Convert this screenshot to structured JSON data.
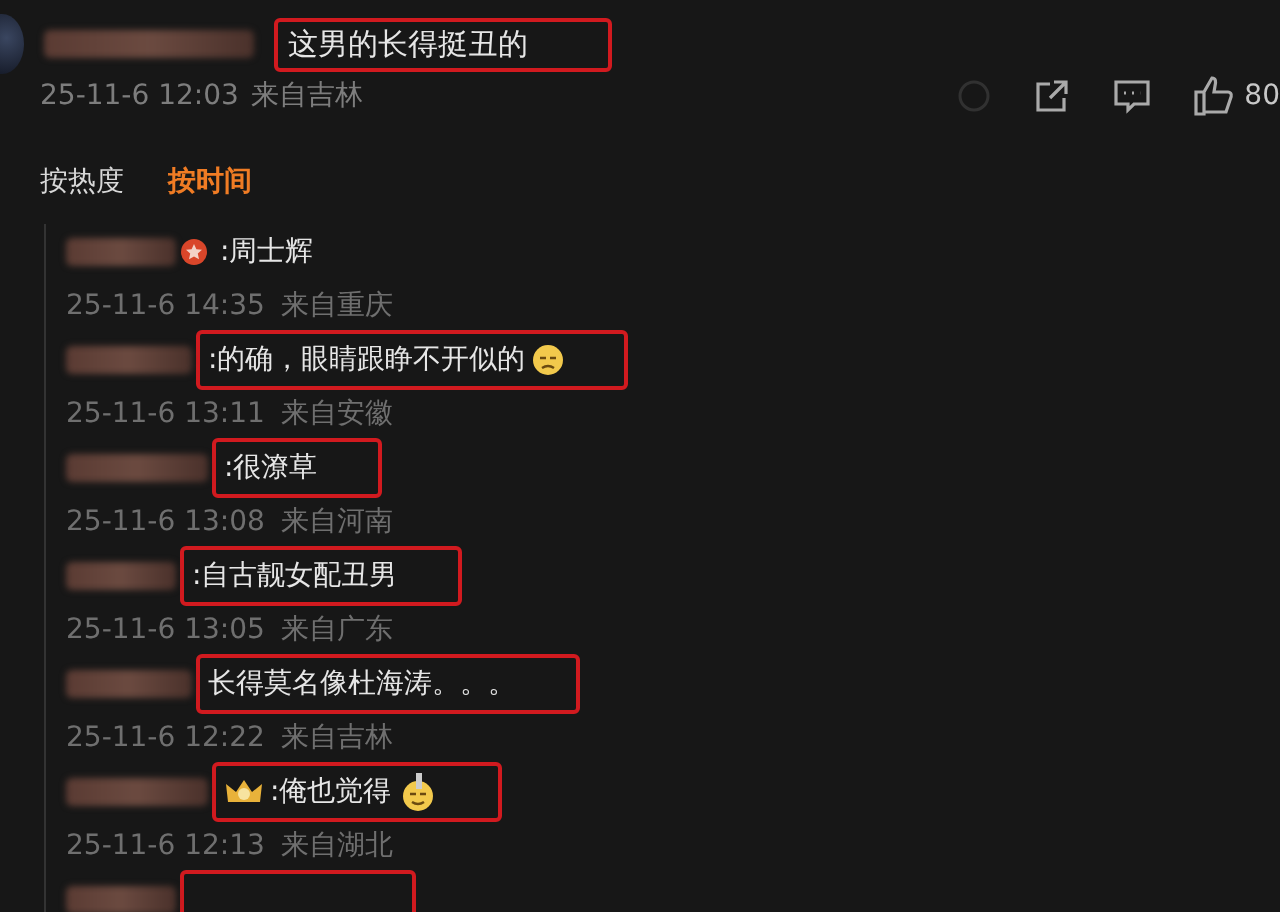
{
  "comment": {
    "text": "这男的长得挺丑的",
    "highlighted": true,
    "time": "25-11-6 12:03",
    "location": "来自吉林",
    "like_count": "80"
  },
  "sort_tabs": [
    {
      "label": "按热度",
      "selected": false
    },
    {
      "label": "按时间",
      "selected": true
    }
  ],
  "replies": [
    {
      "kind": "badged",
      "text": ":周士辉",
      "highlighted": false,
      "time": "25-11-6 14:35",
      "location": "来自重庆"
    },
    {
      "kind": "emoji",
      "text": ":的确，眼睛跟睁不开似的",
      "highlighted": true,
      "time": "25-11-6 13:11",
      "location": "来自安徽"
    },
    {
      "kind": "plain",
      "text": ":很潦草",
      "highlighted": true,
      "time": "25-11-6 13:08",
      "location": "来自河南"
    },
    {
      "kind": "plain",
      "text": ":自古靓女配丑男",
      "highlighted": true,
      "time": "25-11-6 13:05",
      "location": "来自广东"
    },
    {
      "kind": "plain",
      "text": "长得莫名像杜海涛。。。",
      "highlighted": true,
      "time": "25-11-6 12:22",
      "location": "来自吉林"
    },
    {
      "kind": "crowned",
      "text": ":俺也觉得",
      "highlighted": true,
      "time": "25-11-6 12:13",
      "location": "来自湖北"
    },
    {
      "kind": "plain",
      "highlighted": true
    }
  ]
}
